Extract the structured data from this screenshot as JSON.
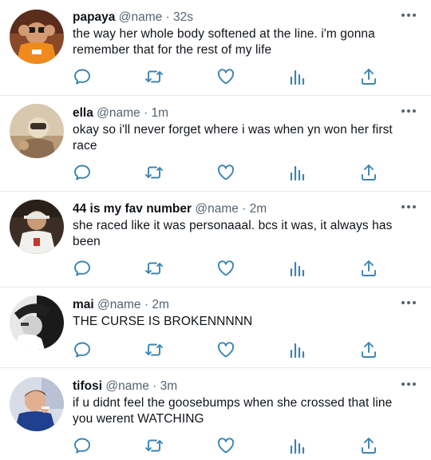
{
  "tweets": [
    {
      "username": "papaya",
      "handle": "@name",
      "separator": "·",
      "time": "32s",
      "text": "the way her whole body softened at the line. i'm gonna remember that for the rest of my life",
      "avatar_icon": "orange-hands-avatar"
    },
    {
      "username": "ella",
      "handle": "@name",
      "separator": "·",
      "time": "1m",
      "text": "okay so i'll never forget where i was when yn won her first race",
      "avatar_icon": "beige-photo-avatar"
    },
    {
      "username": "44 is my fav number",
      "handle": "@name",
      "separator": "·",
      "time": "2m",
      "text": "she raced like it was personaaal. bcs it was, it always has been",
      "avatar_icon": "cap-man-avatar"
    },
    {
      "username": "mai",
      "handle": "@name",
      "separator": "·",
      "time": "2m",
      "text": "THE CURSE IS BROKENNNNN",
      "avatar_icon": "monochrome-avatar"
    },
    {
      "username": "tifosi",
      "handle": "@name",
      "separator": "·",
      "time": "3m",
      "text": "if u didnt feel the goosebumps when she crossed that line you werent WATCHING",
      "avatar_icon": "blue-shirt-avatar"
    }
  ],
  "colors": {
    "icon": "#3b84b3",
    "text": "#0f1419",
    "muted": "#536471",
    "divider": "#e6e9ec"
  }
}
